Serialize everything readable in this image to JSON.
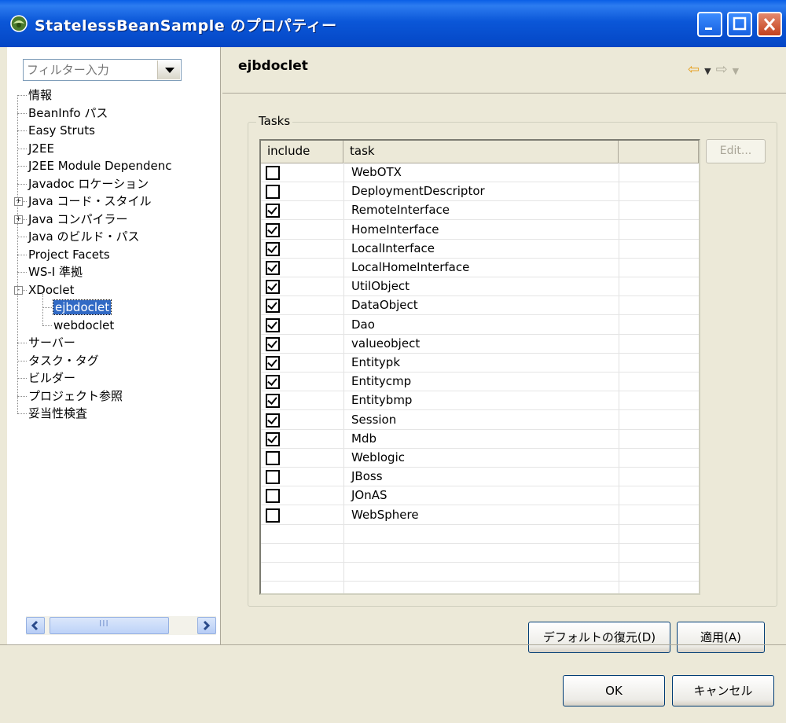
{
  "window": {
    "title": "StatelessBeanSample のプロパティー"
  },
  "filter": {
    "placeholder": "フィルター入力"
  },
  "tree": [
    {
      "label": "情報",
      "level": 0
    },
    {
      "label": "BeanInfo パス",
      "level": 0
    },
    {
      "label": "Easy Struts",
      "level": 0
    },
    {
      "label": "J2EE",
      "level": 0
    },
    {
      "label": "J2EE Module Dependenc",
      "level": 0
    },
    {
      "label": "Javadoc ロケーション",
      "level": 0
    },
    {
      "label": "Java コード・スタイル",
      "level": 0,
      "expander": "+"
    },
    {
      "label": "Java コンパイラー",
      "level": 0,
      "expander": "+"
    },
    {
      "label": "Java のビルド・パス",
      "level": 0
    },
    {
      "label": "Project Facets",
      "level": 0
    },
    {
      "label": "WS-I 準拠",
      "level": 0
    },
    {
      "label": "XDoclet",
      "level": 0,
      "expander": "-"
    },
    {
      "label": "ejbdoclet",
      "level": 1,
      "selected": true
    },
    {
      "label": "webdoclet",
      "level": 1
    },
    {
      "label": "サーバー",
      "level": 0
    },
    {
      "label": "タスク・タグ",
      "level": 0
    },
    {
      "label": "ビルダー",
      "level": 0
    },
    {
      "label": "プロジェクト参照",
      "level": 0
    },
    {
      "label": "妥当性検査",
      "level": 0
    }
  ],
  "page": {
    "title": "ejbdoclet"
  },
  "tasks": {
    "group_label": "Tasks",
    "columns": [
      "include",
      "task",
      ""
    ],
    "edit_label": "Edit...",
    "rows": [
      {
        "task": "WebOTX",
        "include": false
      },
      {
        "task": "DeploymentDescriptor",
        "include": false
      },
      {
        "task": "RemoteInterface",
        "include": true
      },
      {
        "task": "HomeInterface",
        "include": true
      },
      {
        "task": "LocalInterface",
        "include": true
      },
      {
        "task": "LocalHomeInterface",
        "include": true
      },
      {
        "task": "UtilObject",
        "include": true
      },
      {
        "task": "DataObject",
        "include": true
      },
      {
        "task": "Dao",
        "include": true
      },
      {
        "task": "valueobject",
        "include": true
      },
      {
        "task": "Entitypk",
        "include": true
      },
      {
        "task": "Entitycmp",
        "include": true
      },
      {
        "task": "Entitybmp",
        "include": true
      },
      {
        "task": "Session",
        "include": true
      },
      {
        "task": "Mdb",
        "include": true
      },
      {
        "task": "Weblogic",
        "include": false
      },
      {
        "task": "JBoss",
        "include": false
      },
      {
        "task": "JOnAS",
        "include": false
      },
      {
        "task": "WebSphere",
        "include": false
      }
    ]
  },
  "buttons": {
    "restore_defaults": "デフォルトの復元(D)",
    "apply": "適用(A)",
    "ok": "OK",
    "cancel": "キャンセル"
  },
  "scrollbar": {
    "thumb_grip": "III"
  }
}
